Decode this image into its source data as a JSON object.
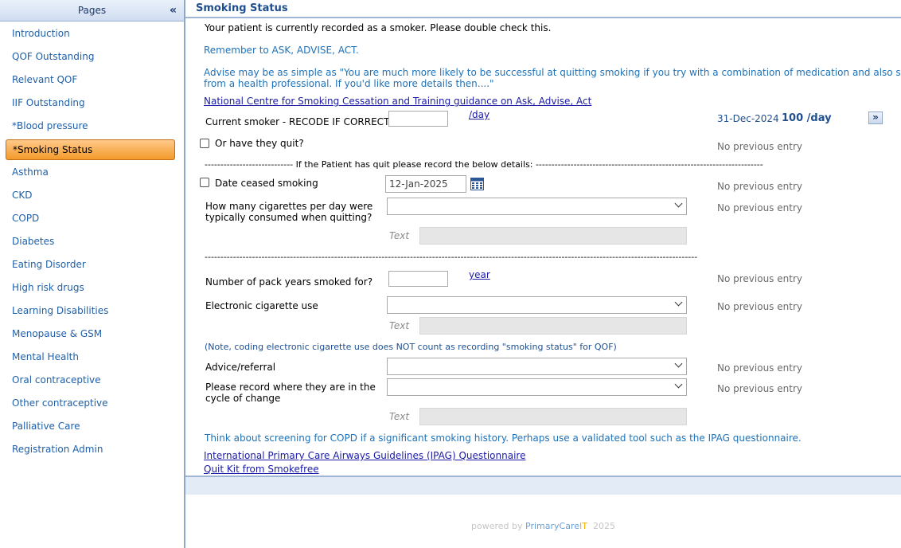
{
  "sidebar": {
    "title": "Pages",
    "collapse_icon": "double-chevron-left-icon",
    "items": [
      {
        "label": "Introduction"
      },
      {
        "label": "QOF Outstanding"
      },
      {
        "label": "Relevant QOF"
      },
      {
        "label": "IIF Outstanding"
      },
      {
        "label": "*Blood pressure"
      },
      {
        "label": "*Smoking Status",
        "active": true
      },
      {
        "label": "Asthma"
      },
      {
        "label": "CKD"
      },
      {
        "label": "COPD"
      },
      {
        "label": "Diabetes"
      },
      {
        "label": "Eating Disorder"
      },
      {
        "label": "High risk drugs"
      },
      {
        "label": "Learning Disabilities"
      },
      {
        "label": "Menopause & GSM"
      },
      {
        "label": "Mental Health"
      },
      {
        "label": "Oral contraceptive"
      },
      {
        "label": "Other contraceptive"
      },
      {
        "label": "Palliative Care"
      },
      {
        "label": "Registration Admin"
      }
    ]
  },
  "main": {
    "title": "Smoking Status",
    "intro": "Your patient is currently recorded as a smoker.  Please double check this.",
    "remember": "Remember to ASK, ADVISE, ACT.",
    "advise": "Advise may be as simple as \"You are much more likely to be successful at quitting smoking if you try with a combination of medication and also support",
    "advise2": "from a health professional.  If you'd like more details then....\"",
    "ncsct_link": "National Centre for Smoking Cessation and Training guidance on Ask, Advise, Act",
    "current_smoker": {
      "label": "Current smoker - RECODE IF CORRECT",
      "value": "",
      "unit": "/day",
      "prev_date": "31-Dec-2024",
      "prev_value": "100 /day",
      "go_icon": "double-chevron-right-icon"
    },
    "quit": {
      "label": "Or have they quit?",
      "checked": false,
      "prev": "No previous entry"
    },
    "quit_divider": "---------------------------- If the Patient has quit please record the below details: ------------------------------------------------------------------------",
    "date_ceased": {
      "label": "Date ceased smoking",
      "checked": false,
      "value": "12-Jan-2025",
      "calendar_icon": "calendar-icon",
      "prev": "No previous entry"
    },
    "cigs_per_day": {
      "label1": "How many cigarettes per day were",
      "label2": "typically consumed when quitting?",
      "value": "",
      "prev": "No previous entry"
    },
    "text_label": "Text",
    "divider2": "------------------------------------------------------------------------------------------------------------------------------------------------------------",
    "pack_years": {
      "label": "Number of pack years smoked for?",
      "value": "",
      "unit": "year",
      "prev": "No previous entry"
    },
    "ecig": {
      "label": "Electronic cigarette use",
      "value": "",
      "prev": "No previous entry"
    },
    "ecig_note": "(Note, coding electronic cigarette use does NOT count as recording \"smoking status\" for QOF)",
    "advice": {
      "label": "Advice/referral",
      "value": "",
      "prev": "No previous entry"
    },
    "cycle": {
      "label1": "Please record where they are in the",
      "label2": "cycle of change",
      "value": "",
      "prev": "No previous entry"
    },
    "copd_note": "Think about screening for COPD if a significant smoking history.  Perhaps use a validated tool such as the IPAG questionnaire.",
    "ipag_link": "International Primary Care Airways Guidelines (IPAG) Questionnaire",
    "quitkit_link": "Quit Kit from Smokefree"
  },
  "footer": {
    "powered": "powered by",
    "brand1": "PrimaryCare",
    "brand2": "IT",
    "year": "2025"
  }
}
